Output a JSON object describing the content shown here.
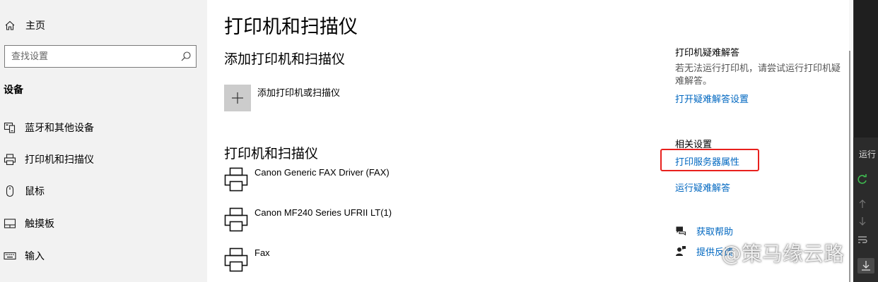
{
  "nav": {
    "home_label": "主页",
    "search_placeholder": "查找设置",
    "section_label": "设备",
    "items": [
      {
        "label": "蓝牙和其他设备",
        "icon": "bluetooth-devices-icon"
      },
      {
        "label": "打印机和扫描仪",
        "icon": "printer-icon"
      },
      {
        "label": "鼠标",
        "icon": "mouse-icon"
      },
      {
        "label": "触摸板",
        "icon": "touchpad-icon"
      },
      {
        "label": "输入",
        "icon": "keyboard-icon"
      }
    ]
  },
  "main": {
    "title": "打印机和扫描仪",
    "add_section_title": "添加打印机和扫描仪",
    "add_button_label": "添加打印机或扫描仪",
    "list_section_title": "打印机和扫描仪",
    "printers": [
      {
        "name": "Canon Generic FAX Driver (FAX)"
      },
      {
        "name": "Canon MF240 Series UFRII LT(1)"
      },
      {
        "name": "Fax"
      }
    ]
  },
  "sidebar_right": {
    "troubleshoot_heading": "打印机疑难解答",
    "troubleshoot_desc": "若无法运行打印机，请尝试运行打印机疑难解答。",
    "troubleshoot_link": "打开疑难解答设置",
    "related_heading": "相关设置",
    "print_server_link": "打印服务器属性",
    "run_troubleshooter_link": "运行疑难解答",
    "get_help_link": "获取帮助",
    "feedback_link": "提供反馈"
  },
  "side_panel": {
    "label": "运行"
  },
  "watermark": "@策马缘云路",
  "colors": {
    "accent_link": "#0067c0",
    "highlight_box": "#e8201d",
    "nav_background": "#f2f2f2",
    "add_tile": "#cccccc"
  }
}
